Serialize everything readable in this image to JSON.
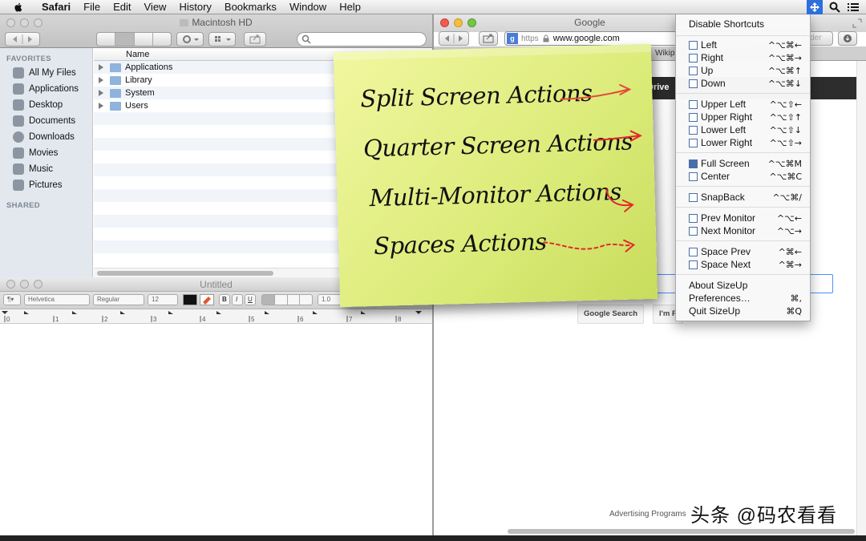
{
  "menubar": {
    "apple": "apple-logo",
    "items": [
      "Safari",
      "File",
      "Edit",
      "View",
      "History",
      "Bookmarks",
      "Window",
      "Help"
    ]
  },
  "finder": {
    "title": "Macintosh HD",
    "sidebar_favorites_heading": "FAVORITES",
    "sidebar_shared_heading": "SHARED",
    "sidebar_items": [
      "All My Files",
      "Applications",
      "Desktop",
      "Documents",
      "Downloads",
      "Movies",
      "Music",
      "Pictures"
    ],
    "column_name": "Name",
    "files": [
      "Applications",
      "Library",
      "System",
      "Users"
    ]
  },
  "textedit": {
    "title": "Untitled",
    "font_family": "Helvetica",
    "font_style": "Regular",
    "font_size": "12",
    "line_spacing": "1.0",
    "bold": "B",
    "italic": "I",
    "underline": "U",
    "ruler_numbers": [
      "0",
      "1",
      "2",
      "3",
      "4",
      "5",
      "6",
      "7",
      "8"
    ]
  },
  "safari": {
    "title": "Google",
    "https_label": "https",
    "url": "www.google.com",
    "reader_label": "der",
    "bookmark_wiki": "Wikip",
    "google_nav": "Drive",
    "google_search_button": "Google Search",
    "feeling_lucky_button": "I'm F",
    "footer_advertising": "Advertising Programs"
  },
  "sticky_note": {
    "lines": [
      "Split Screen Actions",
      "Quarter Screen Actions",
      "Multi-Monitor Actions",
      "Spaces Actions"
    ]
  },
  "sizeup_menu": {
    "disable": "Disable Shortcuts",
    "groups": [
      [
        {
          "label": "Left",
          "shortcut": "^⌥⌘←"
        },
        {
          "label": "Right",
          "shortcut": "^⌥⌘→"
        },
        {
          "label": "Up",
          "shortcut": "^⌥⌘↑"
        },
        {
          "label": "Down",
          "shortcut": "^⌥⌘↓"
        }
      ],
      [
        {
          "label": "Upper Left",
          "shortcut": "^⌥⇧←"
        },
        {
          "label": "Upper Right",
          "shortcut": "^⌥⇧↑"
        },
        {
          "label": "Lower Left",
          "shortcut": "^⌥⇧↓"
        },
        {
          "label": "Lower Right",
          "shortcut": "^⌥⇧→"
        }
      ],
      [
        {
          "label": "Full Screen",
          "shortcut": "^⌥⌘M"
        },
        {
          "label": "Center",
          "shortcut": "^⌥⌘C"
        }
      ],
      [
        {
          "label": "SnapBack",
          "shortcut": "^⌥⌘/"
        }
      ],
      [
        {
          "label": "Prev Monitor",
          "shortcut": "^⌥←"
        },
        {
          "label": "Next Monitor",
          "shortcut": "^⌥→"
        }
      ],
      [
        {
          "label": "Space Prev",
          "shortcut": "^⌘←"
        },
        {
          "label": "Space Next",
          "shortcut": "^⌘→"
        }
      ]
    ],
    "footer": [
      {
        "label": "About SizeUp",
        "shortcut": ""
      },
      {
        "label": "Preferences…",
        "shortcut": "⌘,"
      },
      {
        "label": "Quit SizeUp",
        "shortcut": "⌘Q"
      }
    ]
  },
  "watermark": "头条 @码农看看",
  "colors": {
    "note": "#e4f08a",
    "menu_accent": "#2d6fdc",
    "google_bar": "#2d2d2d",
    "arrow": "#e02a2a"
  }
}
